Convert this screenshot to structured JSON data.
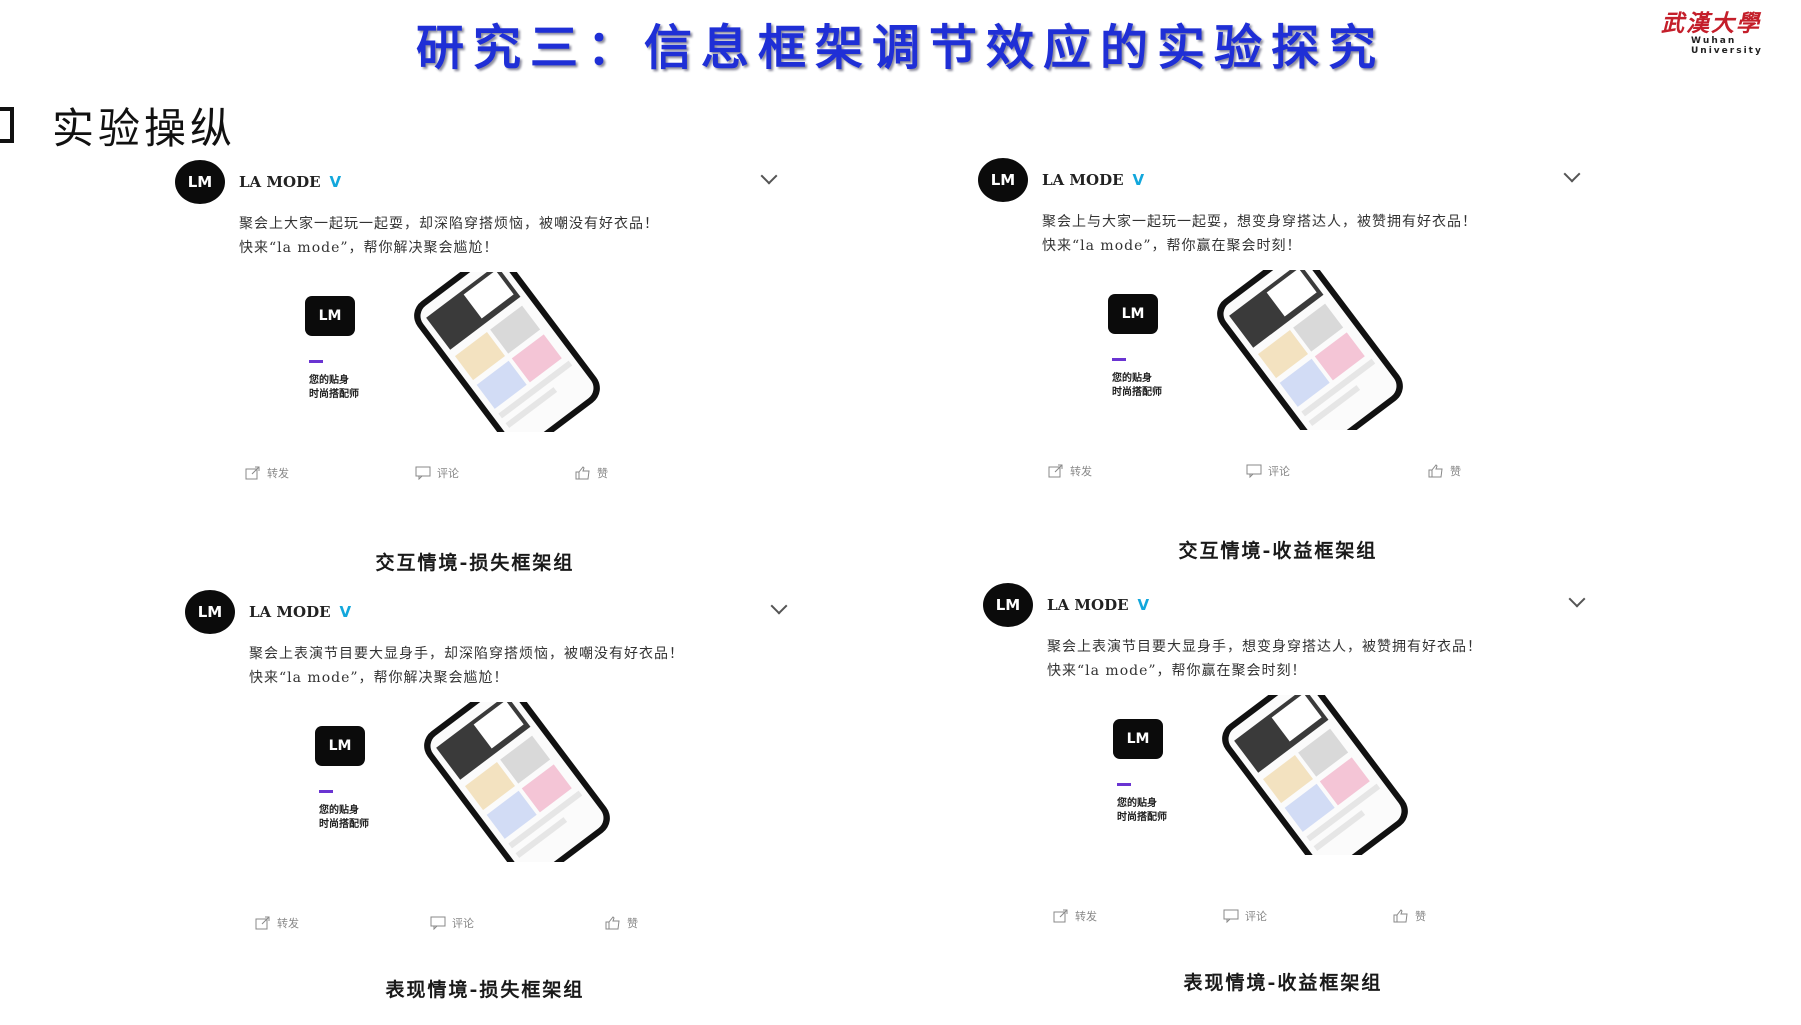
{
  "slide": {
    "title": "研究三：信息框架调节效应的实验探究",
    "logo_cn": "武漢大學",
    "logo_en": "Wuhan University",
    "section": "实验操纵"
  },
  "panels": [
    {
      "brand": "LA MODE",
      "verified_mark": "V",
      "avatar": "LM",
      "text_line1": "聚会上大家一起玩一起耍，却深陷穿搭烦恼，被嘲没有好衣品！",
      "text_line2": "快来“la mode”，帮你解决聚会尴尬！",
      "app_logo": "LM",
      "tagline_line1": "您的贴身",
      "tagline_line2": "时尚搭配师",
      "action_share": "转发",
      "action_comment": "评论",
      "action_like": "赞",
      "caption": "交互情境-损失框架组"
    },
    {
      "brand": "LA MODE",
      "verified_mark": "V",
      "avatar": "LM",
      "text_line1": "聚会上与大家一起玩一起耍，想变身穿搭达人，被赞拥有好衣品！",
      "text_line2": "快来“la mode”，帮你赢在聚会时刻！",
      "app_logo": "LM",
      "tagline_line1": "您的贴身",
      "tagline_line2": "时尚搭配师",
      "action_share": "转发",
      "action_comment": "评论",
      "action_like": "赞",
      "caption": "交互情境-收益框架组"
    },
    {
      "brand": "LA MODE",
      "verified_mark": "V",
      "avatar": "LM",
      "text_line1": "聚会上表演节目要大显身手，却深陷穿搭烦恼，被嘲没有好衣品！",
      "text_line2": "快来“la mode”，帮你解决聚会尴尬！",
      "app_logo": "LM",
      "tagline_line1": "您的贴身",
      "tagline_line2": "时尚搭配师",
      "action_share": "转发",
      "action_comment": "评论",
      "action_like": "赞",
      "caption": "表现情境-损失框架组"
    },
    {
      "brand": "LA MODE",
      "verified_mark": "V",
      "avatar": "LM",
      "text_line1": "聚会上表演节目要大显身手，想变身穿搭达人，被赞拥有好衣品！",
      "text_line2": "快来“la mode”，帮你赢在聚会时刻！",
      "app_logo": "LM",
      "tagline_line1": "您的贴身",
      "tagline_line2": "时尚搭配师",
      "action_share": "转发",
      "action_comment": "评论",
      "action_like": "赞",
      "caption": "表现情境-收益框架组"
    }
  ]
}
